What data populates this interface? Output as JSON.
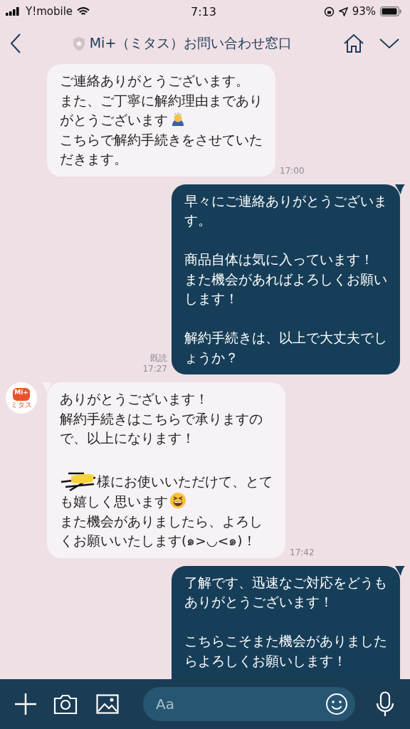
{
  "status_bar": {
    "carrier": "Y!mobile",
    "time": "7:13",
    "battery": "93%"
  },
  "header": {
    "title": "Mi+（ミタス）お問い合わせ窓口"
  },
  "messages": [
    {
      "kind": "incoming",
      "time": "17:00",
      "lines": [
        {
          "kind": "text",
          "text": "ご連絡ありがとうございます。"
        },
        {
          "kind": "text",
          "text": "また、ご丁寧に解約理由まであり"
        },
        {
          "kind": "emoji-bow",
          "text": "がとうございます"
        },
        {
          "kind": "text",
          "text": "こちらで解約手続きをさせていた"
        },
        {
          "kind": "text",
          "text": "だきます。"
        }
      ]
    },
    {
      "kind": "outgoing",
      "read": "既読",
      "time": "17:27",
      "lines": [
        {
          "kind": "text",
          "text": "早々にご連絡ありがとうございま"
        },
        {
          "kind": "text",
          "text": "す。"
        },
        {
          "kind": "blank"
        },
        {
          "kind": "text",
          "text": "商品自体は気に入っています！"
        },
        {
          "kind": "text",
          "text": "また機会があればよろしくお願い"
        },
        {
          "kind": "text",
          "text": "します！"
        },
        {
          "kind": "blank"
        },
        {
          "kind": "text",
          "text": "解約手続きは、以上で大丈夫でし"
        },
        {
          "kind": "text",
          "text": "ょうか？"
        }
      ]
    },
    {
      "kind": "incoming",
      "avatar": {
        "logo": "Mi+",
        "label": "ミタス"
      },
      "time": "17:42",
      "lines": [
        {
          "kind": "text",
          "text": "ありがとうございます！"
        },
        {
          "kind": "text",
          "text": "解約手続きはこちらで承りますの"
        },
        {
          "kind": "text",
          "text": "で、以上になります！"
        },
        {
          "kind": "blank"
        },
        {
          "kind": "redacted",
          "text": "様にお使いいただけて、とて"
        },
        {
          "kind": "emoji-laugh",
          "text": "も嬉しく思います"
        },
        {
          "kind": "text",
          "text": "また機会がありましたら、よろし"
        },
        {
          "kind": "text",
          "text": "くお願いいたします(๑>◡<๑)！"
        }
      ]
    },
    {
      "kind": "outgoing",
      "lines": [
        {
          "kind": "text",
          "text": "了解です、迅速なご対応をどうも"
        },
        {
          "kind": "text",
          "text": "ありがとうございます！"
        },
        {
          "kind": "blank"
        },
        {
          "kind": "text",
          "text": "こちらこそまた機会がありました"
        },
        {
          "kind": "text",
          "text": "らよろしくお願いします！"
        },
        {
          "kind": "blank"
        }
      ]
    }
  ],
  "input_bar": {
    "placeholder": "Aa"
  }
}
